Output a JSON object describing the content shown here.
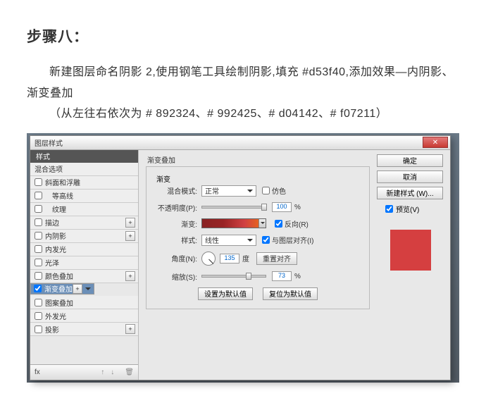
{
  "article": {
    "step_title": "步骤八：",
    "line1": "新建图层命名阴影 2,使用钢笔工具绘制阴影,填充 #d53f40,添加效果—内阴影、渐变叠加",
    "line2": "（从左往右依次为 # 892324、# 992425、# d04142、# f07211）"
  },
  "dialog": {
    "title": "图层样式",
    "left": {
      "header": "样式",
      "items": [
        {
          "label": "混合选项",
          "checkbox": false,
          "plus": false
        },
        {
          "label": "斜面和浮雕",
          "checkbox": true,
          "checked": false,
          "plus": false
        },
        {
          "label": "等高线",
          "checkbox": true,
          "checked": false,
          "plus": false,
          "indent": true
        },
        {
          "label": "纹理",
          "checkbox": true,
          "checked": false,
          "plus": false,
          "indent": true
        },
        {
          "label": "描边",
          "checkbox": true,
          "checked": false,
          "plus": true
        },
        {
          "label": "内阴影",
          "checkbox": true,
          "checked": false,
          "plus": true
        },
        {
          "label": "内发光",
          "checkbox": true,
          "checked": false,
          "plus": false
        },
        {
          "label": "光泽",
          "checkbox": true,
          "checked": false,
          "plus": false
        },
        {
          "label": "颜色叠加",
          "checkbox": true,
          "checked": false,
          "plus": true
        },
        {
          "label": "渐变叠加",
          "checkbox": true,
          "checked": true,
          "plus": true,
          "selected": true
        },
        {
          "label": "图案叠加",
          "checkbox": true,
          "checked": false,
          "plus": false
        },
        {
          "label": "外发光",
          "checkbox": true,
          "checked": false,
          "plus": false
        },
        {
          "label": "投影",
          "checkbox": true,
          "checked": false,
          "plus": true
        }
      ],
      "footer_fx": "fx"
    },
    "panel": {
      "title": "渐变叠加",
      "group_label": "渐变",
      "blend_mode": {
        "label": "混合模式:",
        "value": "正常"
      },
      "dither": "仿色",
      "opacity": {
        "label": "不透明度(P):",
        "value": "100",
        "pct": "%"
      },
      "gradient": {
        "label": "渐变:"
      },
      "reverse": "反向(R)",
      "style": {
        "label": "样式:",
        "value": "线性"
      },
      "align": "与图层对齐(I)",
      "angle": {
        "label": "角度(N):",
        "value": "135",
        "unit": "度"
      },
      "reset_align_btn": "重置对齐",
      "scale": {
        "label": "缩放(S):",
        "value": "73",
        "pct": "%"
      },
      "btn_default": "设置为默认值",
      "btn_reset": "复位为默认值"
    },
    "right": {
      "ok": "确定",
      "cancel": "取消",
      "newstyle": "新建样式 (W)...",
      "preview": "预览(V)",
      "swatch_color": "#d53f40"
    }
  }
}
